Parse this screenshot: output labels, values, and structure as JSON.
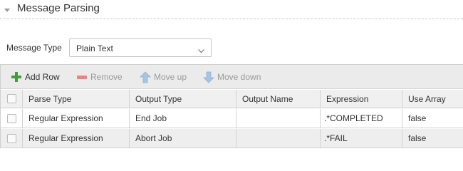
{
  "section": {
    "title": "Message Parsing",
    "collapse_icon": "chevron-down-icon"
  },
  "message_type": {
    "label": "Message Type",
    "selected": "Plain Text",
    "dropdown_icon": "chevron-down-icon"
  },
  "toolbar": {
    "add_row": "Add Row",
    "remove": "Remove",
    "move_up": "Move up",
    "move_down": "Move down",
    "colors": {
      "add_icon": "#3aa13a",
      "remove_icon": "#e88686",
      "move_icon_disabled": "#a8c4e2"
    }
  },
  "table": {
    "columns": [
      "Parse Type",
      "Output Type",
      "Output Name",
      "Expression",
      "Use Array"
    ],
    "rows": [
      {
        "parse_type": "Regular Expression",
        "output_type": "End Job",
        "output_name": "",
        "expression": ".*COMPLETED",
        "use_array": "false"
      },
      {
        "parse_type": "Regular Expression",
        "output_type": "Abort Job",
        "output_name": "",
        "expression": ".*FAIL",
        "use_array": "false"
      }
    ]
  }
}
